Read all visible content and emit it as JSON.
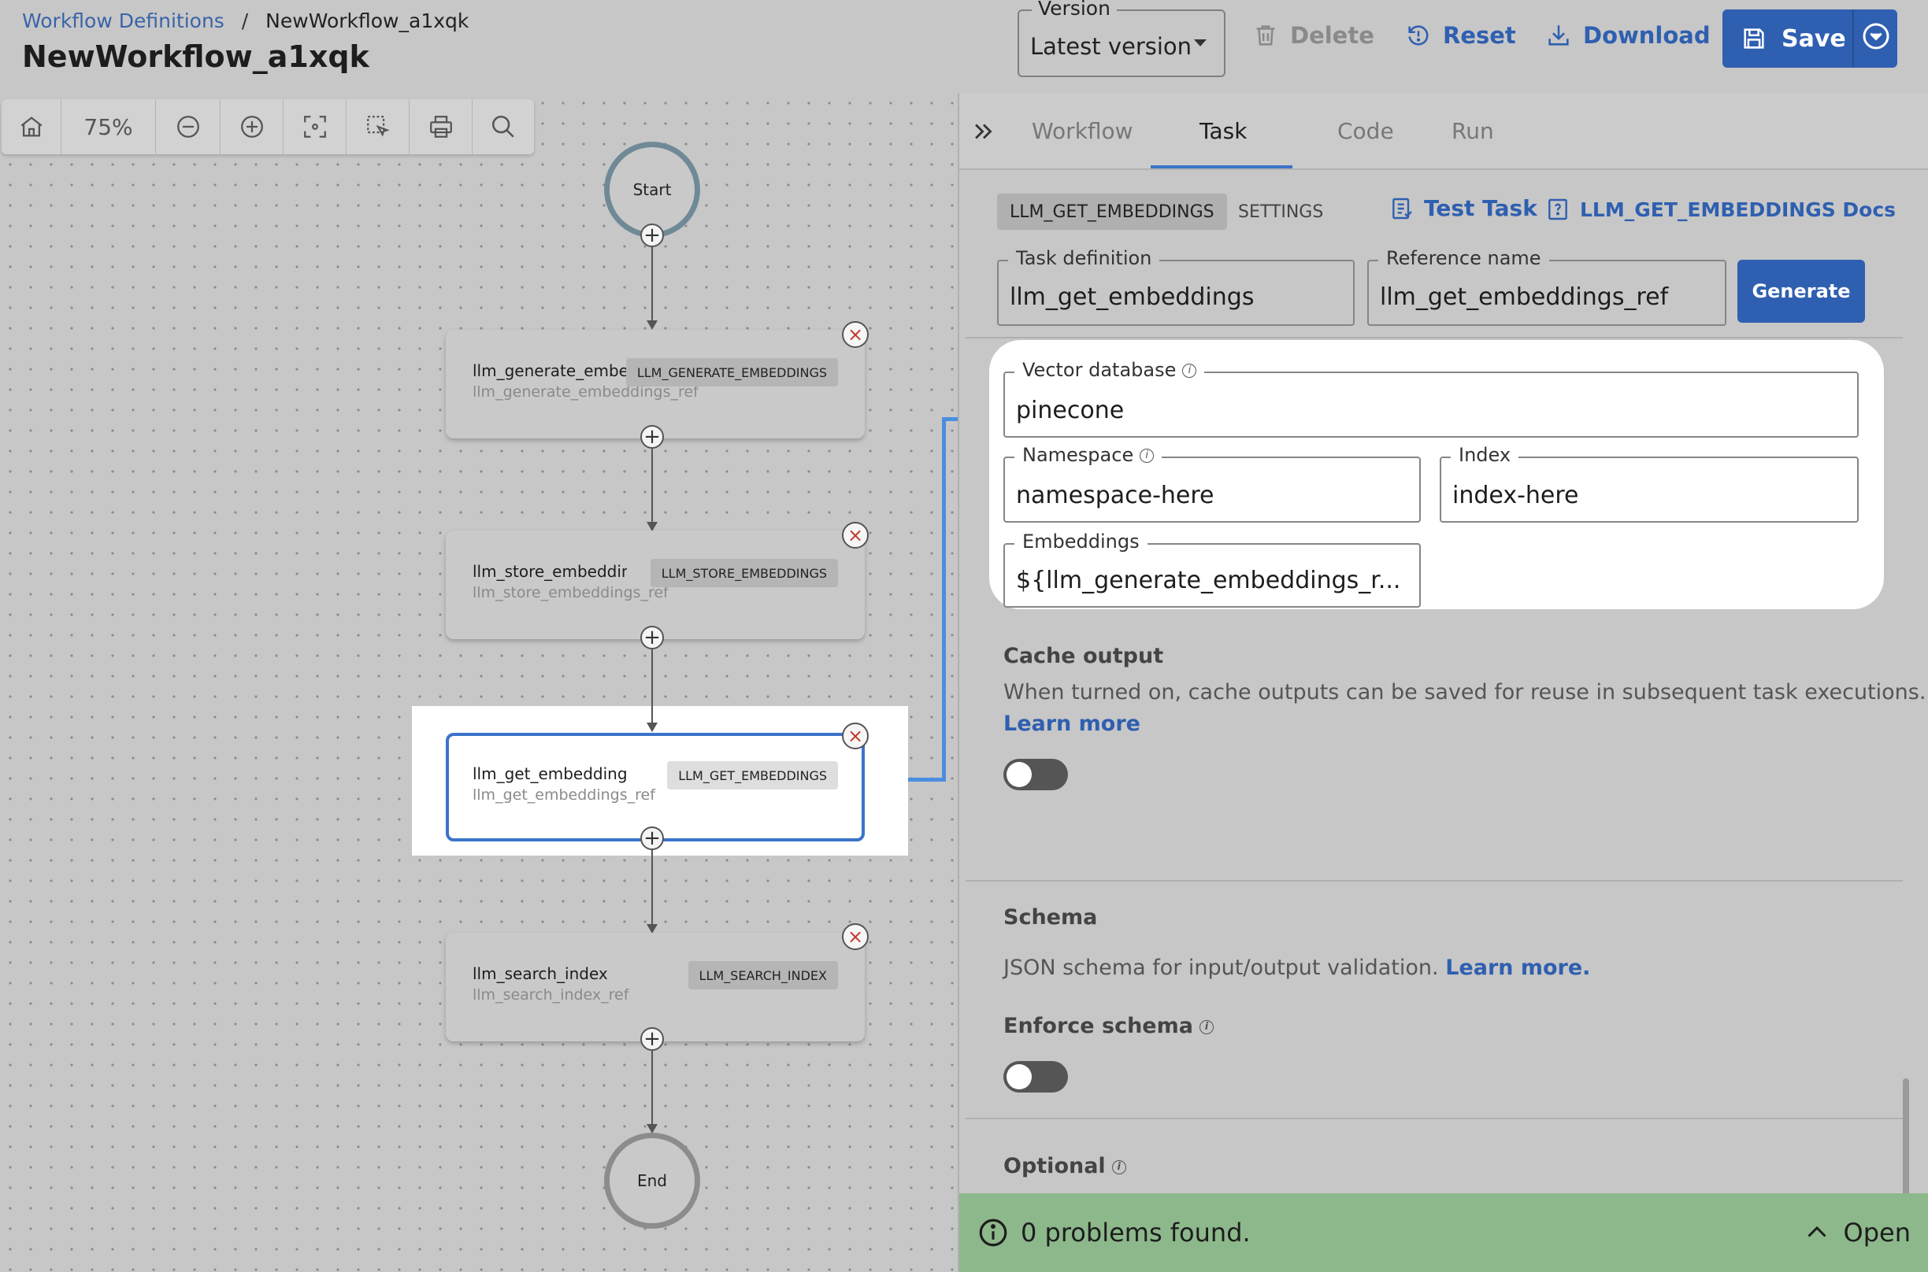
{
  "breadcrumb": {
    "root": "Workflow Definitions",
    "separator": "/",
    "current": "NewWorkflow_a1xqk"
  },
  "page_title": "NewWorkflow_a1xqk",
  "version": {
    "label": "Version",
    "value": "Latest version"
  },
  "actions": {
    "delete": "Delete",
    "reset": "Reset",
    "download": "Download",
    "save": "Save"
  },
  "toolbar": {
    "zoom": "75%",
    "icons": [
      "home-icon",
      "zoom-out-icon",
      "zoom-in-icon",
      "fit-view-icon",
      "select-area-icon",
      "print-icon",
      "search-icon"
    ]
  },
  "graph": {
    "start": "Start",
    "end": "End",
    "tasks": [
      {
        "name": "llm_generate_embeddings",
        "ref": "llm_generate_embeddings_ref",
        "type": "LLM_GENERATE_EMBEDDINGS",
        "selected": false
      },
      {
        "name": "llm_store_embeddings",
        "ref": "llm_store_embeddings_ref",
        "type": "LLM_STORE_EMBEDDINGS",
        "selected": false
      },
      {
        "name": "llm_get_embeddings",
        "ref": "llm_get_embeddings_ref",
        "type": "LLM_GET_EMBEDDINGS",
        "selected": true
      },
      {
        "name": "llm_search_index",
        "ref": "llm_search_index_ref",
        "type": "LLM_SEARCH_INDEX",
        "selected": false
      }
    ]
  },
  "panel": {
    "tabs": [
      "Workflow",
      "Task",
      "Code",
      "Run"
    ],
    "active_tab": "Task",
    "chips": {
      "active": "LLM_GET_EMBEDDINGS",
      "settings": "SETTINGS"
    },
    "test_task": "Test Task",
    "docs": "LLM_GET_EMBEDDINGS Docs",
    "task_definition": {
      "label": "Task definition",
      "value": "llm_get_embeddings"
    },
    "reference_name": {
      "label": "Reference name",
      "value": "llm_get_embeddings_ref"
    },
    "generate": "Generate",
    "vector_database": {
      "label": "Vector database",
      "value": "pinecone"
    },
    "namespace": {
      "label": "Namespace",
      "value": "namespace-here"
    },
    "index": {
      "label": "Index",
      "value": "index-here"
    },
    "embeddings": {
      "label": "Embeddings",
      "value": "${llm_generate_embeddings_r..."
    },
    "cache_output": {
      "title": "Cache output",
      "description": "When turned on, cache outputs can be saved for reuse in subsequent task executions.",
      "link": "Learn more"
    },
    "schema": {
      "title": "Schema",
      "description": "JSON schema for input/output validation.",
      "link": "Learn more."
    },
    "enforce_schema": "Enforce schema",
    "optional": "Optional"
  },
  "status_bar": {
    "message": "0 problems found.",
    "action": "Open"
  },
  "colors": {
    "accent": "#2f5fb0",
    "selection": "#3b73c9",
    "status_ok": "#8db88b"
  }
}
